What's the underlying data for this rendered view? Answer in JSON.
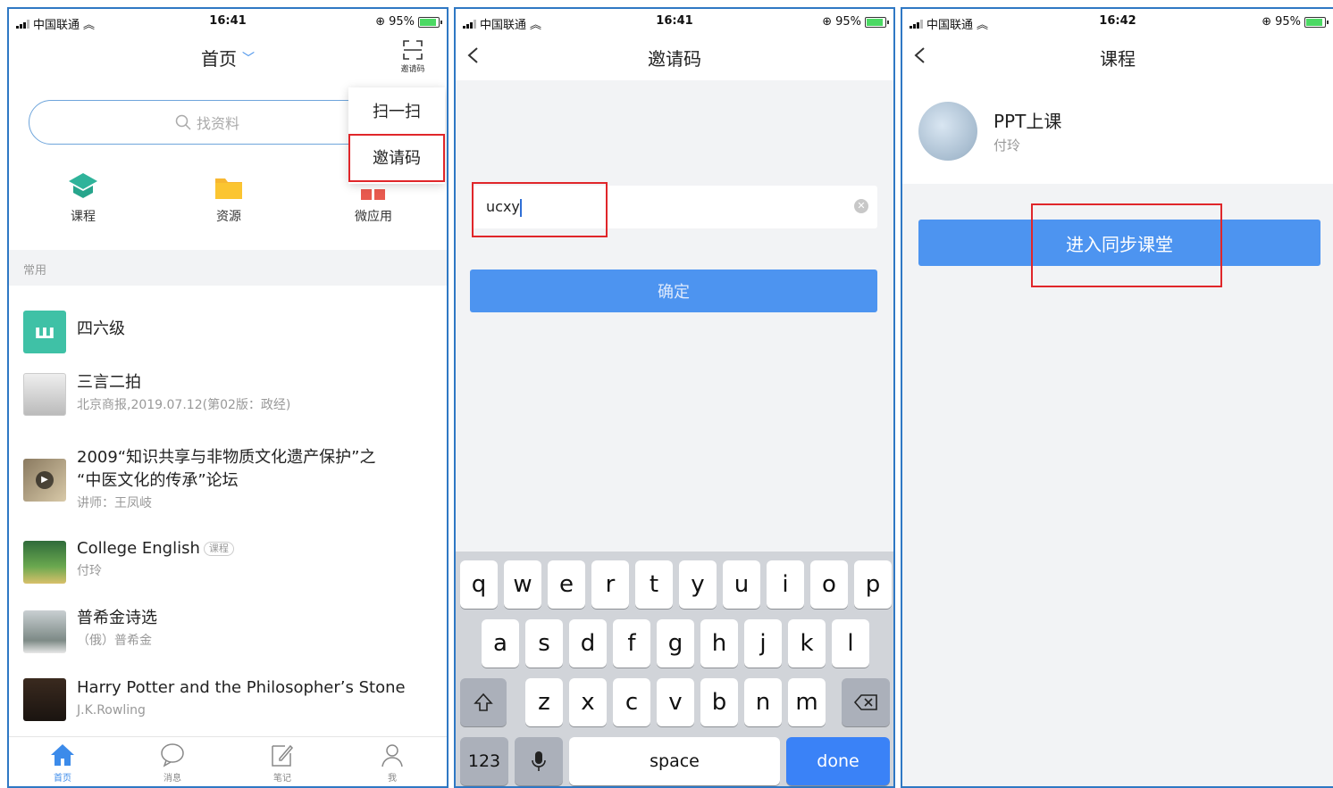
{
  "status_bars": [
    {
      "carrier": "中国联通",
      "time": "16:41",
      "battery": "95%"
    },
    {
      "carrier": "中国联通",
      "time": "16:41",
      "battery": "95%"
    },
    {
      "carrier": "中国联通",
      "time": "16:42",
      "battery": "95%"
    }
  ],
  "colors": {
    "accent": "#4d94f0",
    "highlight_box": "#e0262a",
    "panel_border": "#2f78c4"
  },
  "panel1": {
    "title": "首页",
    "scan_label": "邀请码",
    "search_placeholder": "找资料",
    "popup_menu": [
      "扫一扫",
      "邀请码"
    ],
    "quick_entries": [
      {
        "label": "课程",
        "icon": "course-icon"
      },
      {
        "label": "资源",
        "icon": "folder-icon"
      },
      {
        "label": "微应用",
        "icon": "apps-icon"
      }
    ],
    "section_label": "常用",
    "list": [
      {
        "title": "四六级",
        "subtitle": ""
      },
      {
        "title": "三言二拍",
        "subtitle": "北京商报,2019.07.12(第02版：政经)"
      },
      {
        "title": "2009“知识共享与非物质文化遗产保护”之",
        "title2": "“中医文化的传承”论坛",
        "subtitle": "讲师：王凤岐"
      },
      {
        "title": "College English",
        "tag": "课程",
        "subtitle": "付玲"
      },
      {
        "title": "普希金诗选",
        "subtitle": "（俄）普希金"
      },
      {
        "title": "Harry Potter and the Philosopher’s Stone",
        "subtitle": "J.K.Rowling"
      }
    ],
    "tabs": [
      {
        "label": "首页",
        "icon": "home-icon"
      },
      {
        "label": "消息",
        "icon": "message-icon"
      },
      {
        "label": "笔记",
        "icon": "note-icon"
      },
      {
        "label": "我",
        "icon": "profile-icon"
      }
    ]
  },
  "panel2": {
    "title": "邀请码",
    "input_value": "ucxy",
    "confirm_label": "确定",
    "keyboard": {
      "row1": [
        "q",
        "w",
        "e",
        "r",
        "t",
        "y",
        "u",
        "i",
        "o",
        "p"
      ],
      "row2": [
        "a",
        "s",
        "d",
        "f",
        "g",
        "h",
        "j",
        "k",
        "l"
      ],
      "row3": [
        "z",
        "x",
        "c",
        "v",
        "b",
        "n",
        "m"
      ],
      "numbers": "123",
      "space": "space",
      "done": "done"
    }
  },
  "panel3": {
    "title": "课程",
    "course_name": "PPT上课",
    "teacher": "付玲",
    "enter_label": "进入同步课堂"
  }
}
